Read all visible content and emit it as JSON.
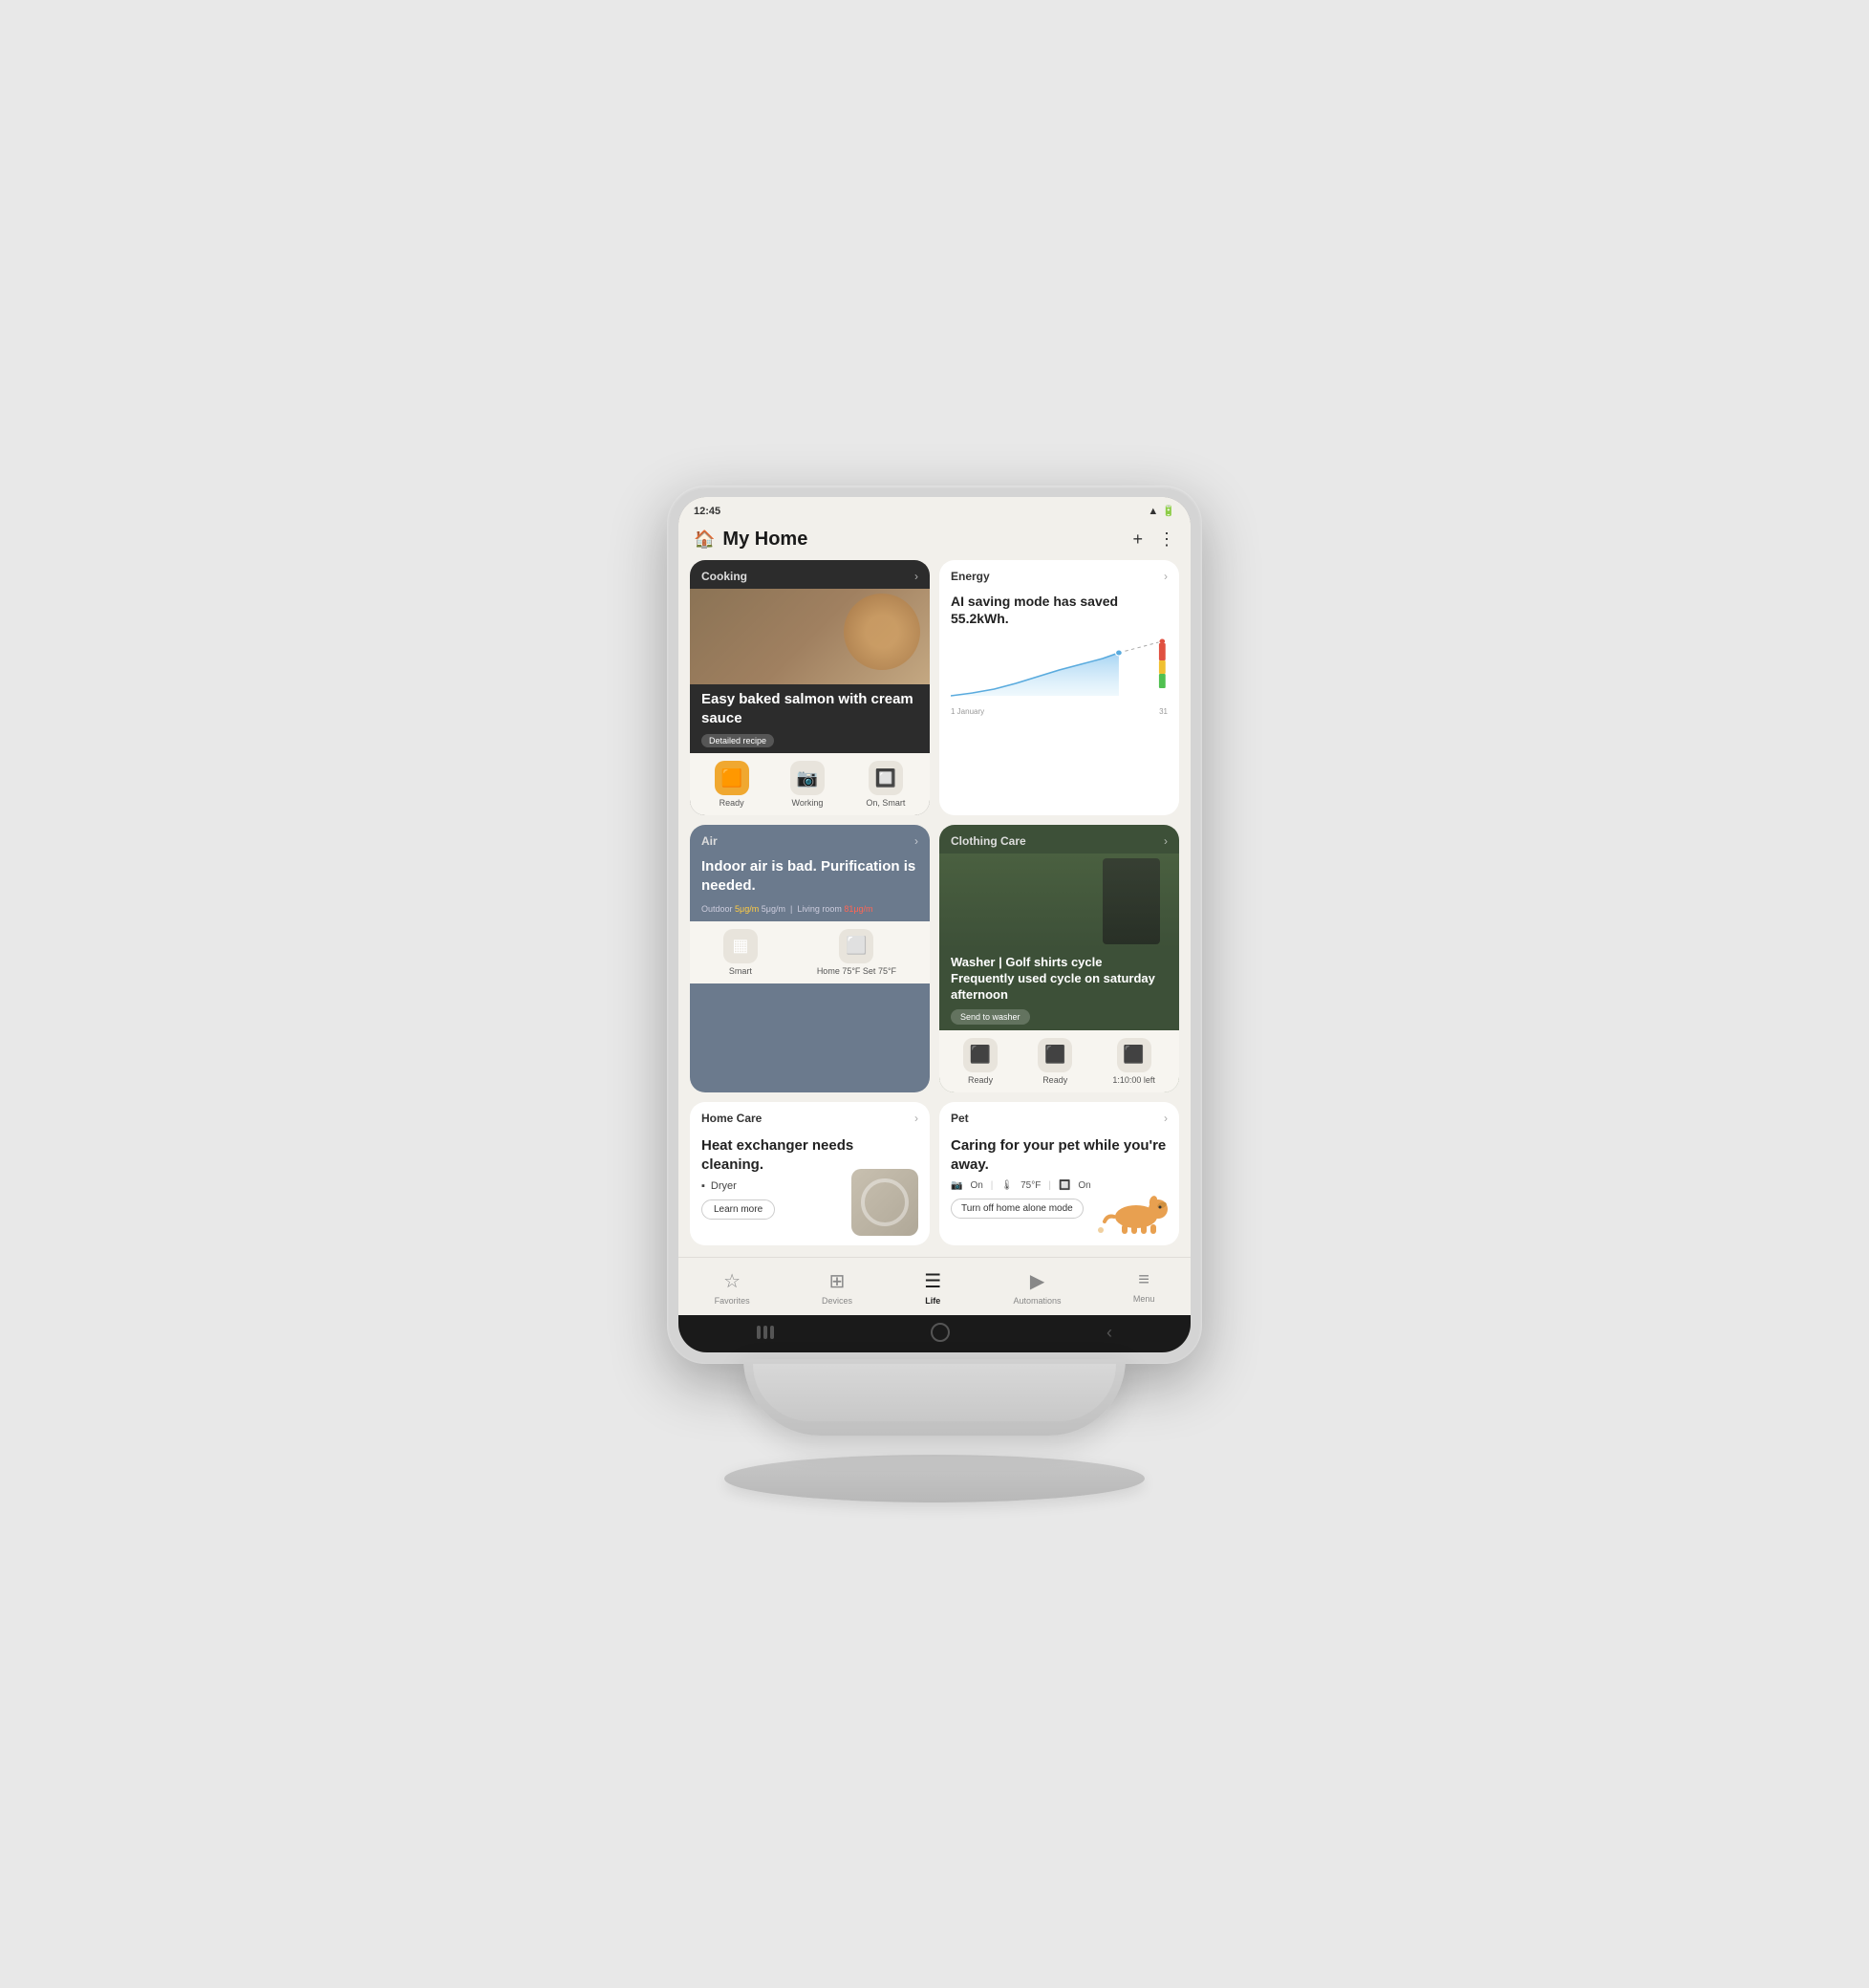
{
  "status_bar": {
    "time": "12:45",
    "signal_icon": "signal",
    "battery_icon": "battery"
  },
  "header": {
    "home_icon": "🏠",
    "title": "My Home",
    "add_icon": "+",
    "menu_icon": "⋮"
  },
  "cooking_card": {
    "label": "Cooking",
    "title": "Easy baked salmon with cream sauce",
    "recipe_badge": "Detailed recipe",
    "device1_status": "Ready",
    "device2_status": "Working",
    "device3_status": "On, Smart"
  },
  "energy_card": {
    "label": "Energy",
    "title": "AI saving mode has saved 55.2kWh.",
    "date_start": "1 January",
    "date_end": "31"
  },
  "air_card": {
    "label": "Air",
    "title": "Indoor air is bad. Purification is needed.",
    "outdoor_label": "Outdoor",
    "outdoor_value": "5μg/m",
    "living_room_label": "Living room",
    "living_room_value": "81μg/m",
    "device1_status": "Smart",
    "device2_status": "Home 75°F Set 75°F"
  },
  "clothing_card": {
    "label": "Clothing Care",
    "title": "Washer | Golf shirts cycle Frequently used cycle on saturday afternoon",
    "send_btn": "Send to washer",
    "device1_status": "Ready",
    "device2_status": "Ready",
    "device3_status": "1:10:00 left"
  },
  "homecare_card": {
    "label": "Home Care",
    "title": "Heat exchanger needs cleaning.",
    "device_name": "Dryer",
    "learn_more_btn": "Learn more"
  },
  "pet_card": {
    "label": "Pet",
    "title": "Caring for your pet while you're away.",
    "stat1": "On",
    "stat2": "75°F",
    "stat3": "On",
    "home_alone_btn": "Turn off home alone mode"
  },
  "bottom_nav": {
    "favorites": "Favorites",
    "devices": "Devices",
    "life": "Life",
    "automations": "Automations",
    "menu": "Menu"
  }
}
